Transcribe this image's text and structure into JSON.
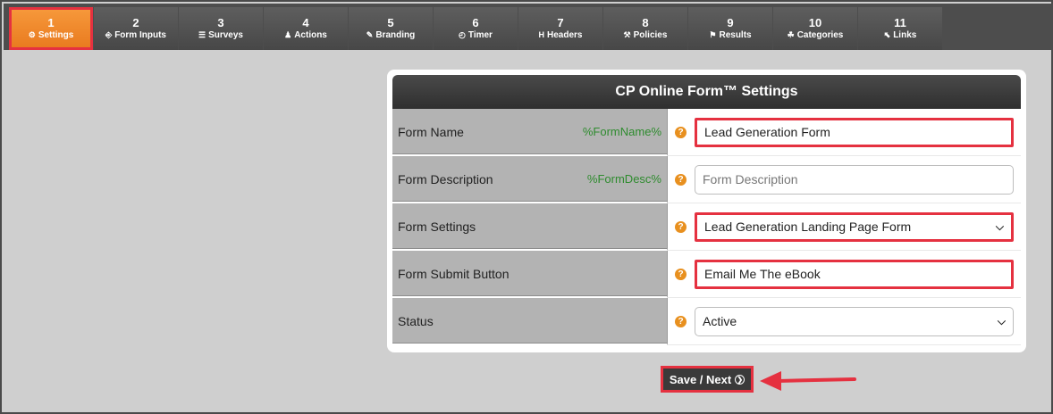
{
  "tabs": [
    {
      "num": "1",
      "label": "Settings",
      "icon": "⚙"
    },
    {
      "num": "2",
      "label": "Form Inputs",
      "icon": "⎆"
    },
    {
      "num": "3",
      "label": "Surveys",
      "icon": "☰"
    },
    {
      "num": "4",
      "label": "Actions",
      "icon": "♟"
    },
    {
      "num": "5",
      "label": "Branding",
      "icon": "✎"
    },
    {
      "num": "6",
      "label": "Timer",
      "icon": "◴"
    },
    {
      "num": "7",
      "label": "Headers",
      "icon": "H"
    },
    {
      "num": "8",
      "label": "Policies",
      "icon": "⚒"
    },
    {
      "num": "9",
      "label": "Results",
      "icon": "⚑"
    },
    {
      "num": "10",
      "label": "Categories",
      "icon": "☘"
    },
    {
      "num": "11",
      "label": "Links",
      "icon": "⬉"
    }
  ],
  "panel": {
    "title": "CP Online Form™ Settings",
    "rows": [
      {
        "label": "Form Name",
        "var": "%FormName%",
        "value": "Lead Generation Form"
      },
      {
        "label": "Form Description",
        "var": "%FormDesc%",
        "placeholder": "Form Description"
      },
      {
        "label": "Form Settings",
        "var": "",
        "value": "Lead Generation Landing Page Form"
      },
      {
        "label": "Form Submit Button",
        "var": "",
        "value": "Email Me The eBook"
      },
      {
        "label": "Status",
        "var": "",
        "value": "Active"
      }
    ],
    "help_glyph": "?"
  },
  "save_button": {
    "label": "Save / Next"
  },
  "colors": {
    "accent": "#e8791e",
    "highlight": "#e53140",
    "var": "#2e8b2e"
  }
}
